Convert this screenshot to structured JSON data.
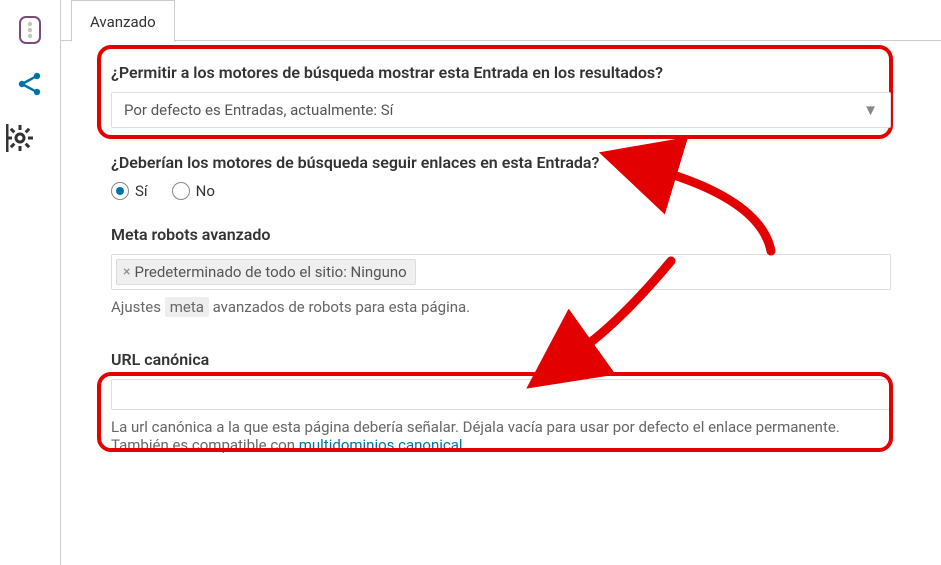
{
  "tabs": {
    "advanced": "Avanzado"
  },
  "search_engines_show": {
    "label": "¿Permitir a los motores de búsqueda mostrar esta Entrada en los resultados?",
    "value": "Por defecto es Entradas, actualmente: Sí"
  },
  "follow_links": {
    "label": "¿Deberían los motores de búsqueda seguir enlaces en esta Entrada?",
    "yes": "Sí",
    "no": "No"
  },
  "meta_robots": {
    "label": "Meta robots avanzado",
    "chip": "Predeterminado de todo el sitio: Ninguno",
    "help_pre": "Ajustes ",
    "help_code": "meta",
    "help_post": " avanzados de robots para esta página."
  },
  "canonical": {
    "label": "URL canónica",
    "value": "",
    "help_pre": "La url canónica a la que esta página debería señalar. Déjala vacía para usar por defecto el enlace permanente. También es compatible con ",
    "help_link": "multidominios canonical",
    "help_post": "."
  }
}
